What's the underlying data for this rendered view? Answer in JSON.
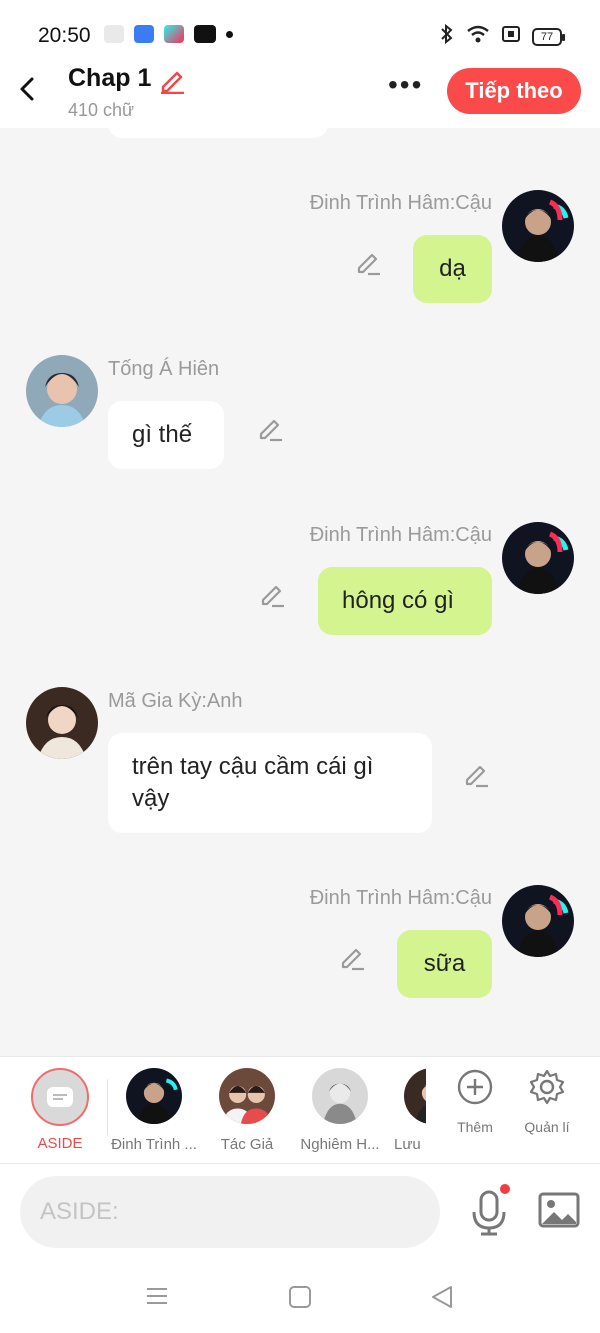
{
  "status_bar": {
    "time": "20:50",
    "battery": "77"
  },
  "header": {
    "title": "Chap 1",
    "word_count": "410 chữ",
    "more_label": "•••",
    "next_button": "Tiếp theo"
  },
  "messages": [
    {
      "sender": "Đinh Trình Hâm:Cậu",
      "text": "dạ",
      "side": "right"
    },
    {
      "sender": "Tống Á Hiên",
      "text": "gì thế",
      "side": "left"
    },
    {
      "sender": "Đinh Trình Hâm:Cậu",
      "text": "hông có gì",
      "side": "right"
    },
    {
      "sender": "Mã Gia Kỳ:Anh",
      "text": "trên tay cậu cầm cái gì vậy",
      "side": "left"
    },
    {
      "sender": "Đinh Trình Hâm:Cậu",
      "text": "sữa",
      "side": "right"
    }
  ],
  "character_bar": {
    "aside_label": "ASIDE",
    "characters": [
      "Đinh Trình ...",
      "Tác Giả",
      "Nghiêm H...",
      "Lưu I"
    ],
    "add_label": "Thêm",
    "manage_label": "Quản lí"
  },
  "input": {
    "placeholder": "ASIDE:"
  },
  "colors": {
    "accent": "#fb4a4a",
    "bubble_self": "#d4f48f",
    "bubble_other": "#ffffff",
    "background": "#f5f5f5"
  },
  "icons": [
    "back-icon",
    "edit-icon",
    "more-icon",
    "add-icon",
    "gear-icon",
    "mic-icon",
    "image-icon"
  ]
}
